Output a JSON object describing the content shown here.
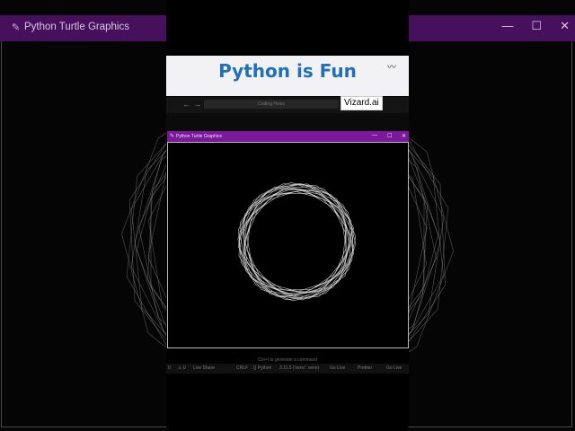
{
  "background_window": {
    "title": "Python Turtle Graphics",
    "feather_icon": "✎",
    "controls": [
      "—",
      "☐",
      "✕"
    ]
  },
  "banner": {
    "text": "Python is Fun"
  },
  "watermark": {
    "text": "Vizard.ai"
  },
  "editor": {
    "back_icon": "←",
    "forward_icon": "→",
    "search_placeholder": "Coding Hexis"
  },
  "turtle_window": {
    "title": "Python Turtle Graphics",
    "feather_icon": "✎",
    "minimize": "—",
    "maximize": "☐",
    "close": "✕"
  },
  "hint_text": "Ctrl+I to generate a command",
  "status_bar": {
    "items": [
      "0",
      "⚠ 0",
      "Live Share",
      "CRLF",
      "{} Python",
      "3.11.5 ('venv': venv)",
      "Go Live",
      "Prettier",
      "Go Live"
    ]
  },
  "colors": {
    "bg_titlebar": "#47105c",
    "turtle_titlebar": "#7b189b",
    "banner_text": "#1f6fb9",
    "line": "#d9d9d9"
  }
}
